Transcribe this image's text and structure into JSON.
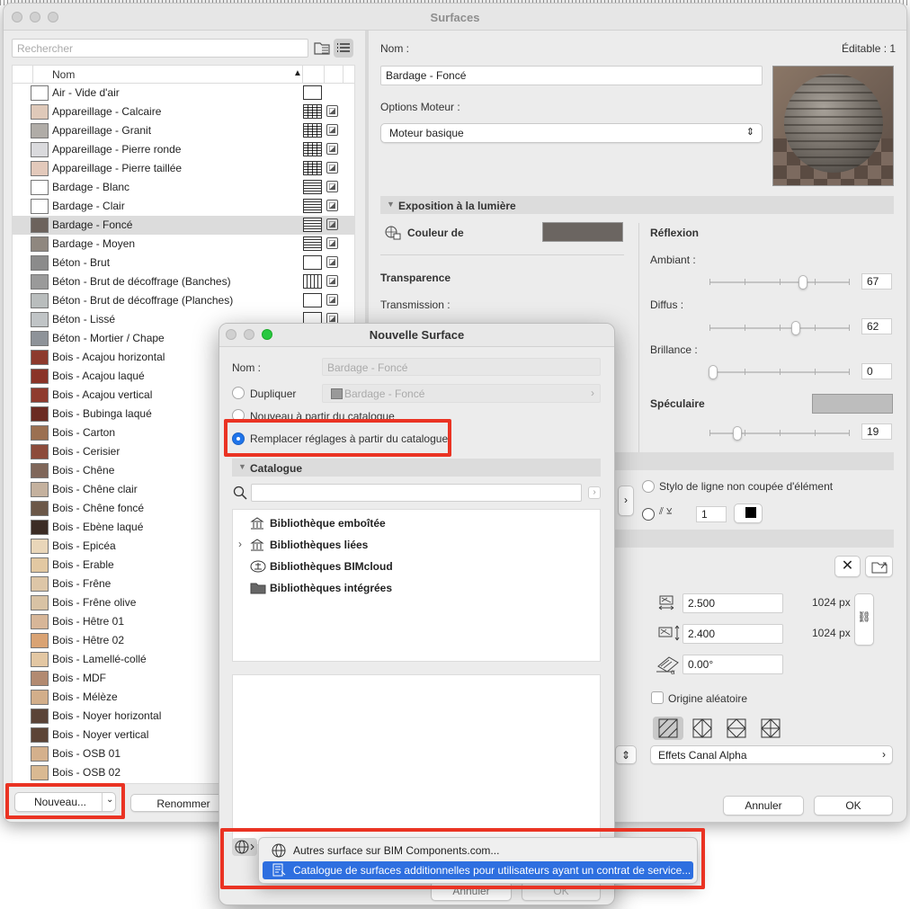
{
  "window": {
    "title": "Surfaces",
    "search_placeholder": "Rechercher",
    "list_header": "Nom",
    "surfaces": [
      {
        "name": "Air - Vide d'air",
        "color": "#ffffff",
        "hatch": "none"
      },
      {
        "name": "Appareillage - Calcaire",
        "color": "#dfc9b9",
        "hatch": "brick"
      },
      {
        "name": "Appareillage - Granit",
        "color": "#b0aca7",
        "hatch": "brick"
      },
      {
        "name": "Appareillage - Pierre ronde",
        "color": "#dadadd",
        "hatch": "brick"
      },
      {
        "name": "Appareillage - Pierre taillée",
        "color": "#e3c9bb",
        "hatch": "brick"
      },
      {
        "name": "Bardage - Blanc",
        "color": "#ffffff",
        "hatch": "horizontal"
      },
      {
        "name": "Bardage - Clair",
        "color": "#ffffff",
        "hatch": "horizontal"
      },
      {
        "name": "Bardage - Foncé",
        "color": "#6c625c",
        "hatch": "horizontal"
      },
      {
        "name": "Bardage - Moyen",
        "color": "#8f877f",
        "hatch": "horizontal"
      },
      {
        "name": "Béton - Brut",
        "color": "#8b8b8b",
        "hatch": "none"
      },
      {
        "name": "Béton - Brut de décoffrage (Banches)",
        "color": "#9a9a9a",
        "hatch": "vertical"
      },
      {
        "name": "Béton - Brut de décoffrage (Planches)",
        "color": "#b9bdbd",
        "hatch": "none"
      },
      {
        "name": "Béton - Lissé",
        "color": "#c0c4c6",
        "hatch": "none"
      },
      {
        "name": "Béton - Mortier / Chape",
        "color": "#8e9399",
        "hatch": "none"
      },
      {
        "name": "Bois - Acajou horizontal",
        "color": "#8d3a2d",
        "hatch": "none"
      },
      {
        "name": "Bois - Acajou laqué",
        "color": "#8a3428",
        "hatch": "none"
      },
      {
        "name": "Bois - Acajou vertical",
        "color": "#8f3b2e",
        "hatch": "none"
      },
      {
        "name": "Bois - Bubinga laqué",
        "color": "#6b2b22",
        "hatch": "none"
      },
      {
        "name": "Bois - Carton",
        "color": "#9b7051",
        "hatch": "none"
      },
      {
        "name": "Bois - Cerisier",
        "color": "#8c4b3b",
        "hatch": "none"
      },
      {
        "name": "Bois - Chêne",
        "color": "#7f6659",
        "hatch": "none"
      },
      {
        "name": "Bois - Chêne clair",
        "color": "#c4b19e",
        "hatch": "none"
      },
      {
        "name": "Bois - Chêne foncé",
        "color": "#6b5748",
        "hatch": "none"
      },
      {
        "name": "Bois - Ebène laqué",
        "color": "#3b2c25",
        "hatch": "none"
      },
      {
        "name": "Bois - Epicéa",
        "color": "#e9d6b9",
        "hatch": "none"
      },
      {
        "name": "Bois - Erable",
        "color": "#e2c8a2",
        "hatch": "none"
      },
      {
        "name": "Bois - Frêne",
        "color": "#ddc6a7",
        "hatch": "none"
      },
      {
        "name": "Bois - Frêne olive",
        "color": "#d8c2a4",
        "hatch": "none"
      },
      {
        "name": "Bois - Hêtre 01",
        "color": "#d7b698",
        "hatch": "none"
      },
      {
        "name": "Bois - Hêtre 02",
        "color": "#d9a374",
        "hatch": "none"
      },
      {
        "name": "Bois - Lamellé-collé",
        "color": "#e3c7a3",
        "hatch": "none"
      },
      {
        "name": "Bois - MDF",
        "color": "#b28a71",
        "hatch": "none"
      },
      {
        "name": "Bois - Mélèze",
        "color": "#d2ae8a",
        "hatch": "none"
      },
      {
        "name": "Bois - Noyer horizontal",
        "color": "#5a4337",
        "hatch": "none"
      },
      {
        "name": "Bois - Noyer vertical",
        "color": "#5c4436",
        "hatch": "none"
      },
      {
        "name": "Bois - OSB 01",
        "color": "#d4b08c",
        "hatch": "none"
      },
      {
        "name": "Bois - OSB 02",
        "color": "#d9b992",
        "hatch": "none"
      }
    ],
    "selected_index": 7,
    "nouveau_label": "Nouveau...",
    "renommer_label": "Renommer",
    "nom_label": "Nom :",
    "editable_label": "Éditable : 1",
    "name_value": "Bardage - Foncé",
    "options_moteur_label": "Options Moteur :",
    "moteur_value": "Moteur basique",
    "exposition_label": "Exposition à la lumière",
    "couleur_label": "Couleur de",
    "couleur_swatch": "#6b6561",
    "transparence_label": "Transparence",
    "transmission_label": "Transmission :",
    "reflexion_label": "Réflexion",
    "ambiant_label": "Ambiant :",
    "ambiant_value": "67",
    "diffus_label": "Diffus :",
    "diffus_value": "62",
    "brillance_label": "Brillance :",
    "brillance_value": "0",
    "speculaire_label": "Spéculaire",
    "speculaire_swatch": "#bdbdbd",
    "speculaire_value": "19",
    "stylo_label": "Stylo de ligne non coupée d'élément",
    "stylo_value": "1",
    "width_value": "2.500",
    "width_px": "1024 px",
    "height_value": "2.400",
    "height_px": "1024 px",
    "angle_value": "0.00°",
    "origine_label": "Origine aléatoire",
    "alpha_label": "Effets Canal Alpha",
    "annuler_label": "Annuler",
    "ok_label": "OK"
  },
  "dialog": {
    "title": "Nouvelle Surface",
    "nom_label": "Nom :",
    "nom_placeholder": "Bardage - Foncé",
    "dupliquer_label": "Dupliquer",
    "dupliquer_value": "Bardage - Foncé",
    "nouveau_catalogue_label": "Nouveau à partir du catalogue",
    "remplacer_label": "Remplacer réglages à partir du catalogue",
    "catalogue_label": "Catalogue",
    "libraries": [
      {
        "name": "Bibliothèque emboîtée",
        "icon": "library-icon",
        "expandable": false
      },
      {
        "name": "Bibliothèques liées",
        "icon": "library-icon",
        "expandable": true
      },
      {
        "name": "Bibliothèques BIMcloud",
        "icon": "bimcloud-icon",
        "expandable": false
      },
      {
        "name": "Bibliothèques intégrées",
        "icon": "folder-icon",
        "expandable": false
      }
    ],
    "annuler_label": "Annuler",
    "ok_label": "OK"
  },
  "popup_menu": {
    "items": [
      {
        "label": "Autres surface sur BIM Components.com...",
        "icon": "globe-icon",
        "highlighted": false
      },
      {
        "label": "Catalogue de surfaces additionnelles pour utilisateurs ayant un contrat de service...",
        "icon": "catalog-icon",
        "highlighted": true
      }
    ]
  },
  "colors": {
    "highlight_red": "#ea3323",
    "accent_blue": "#2e6fe0"
  }
}
